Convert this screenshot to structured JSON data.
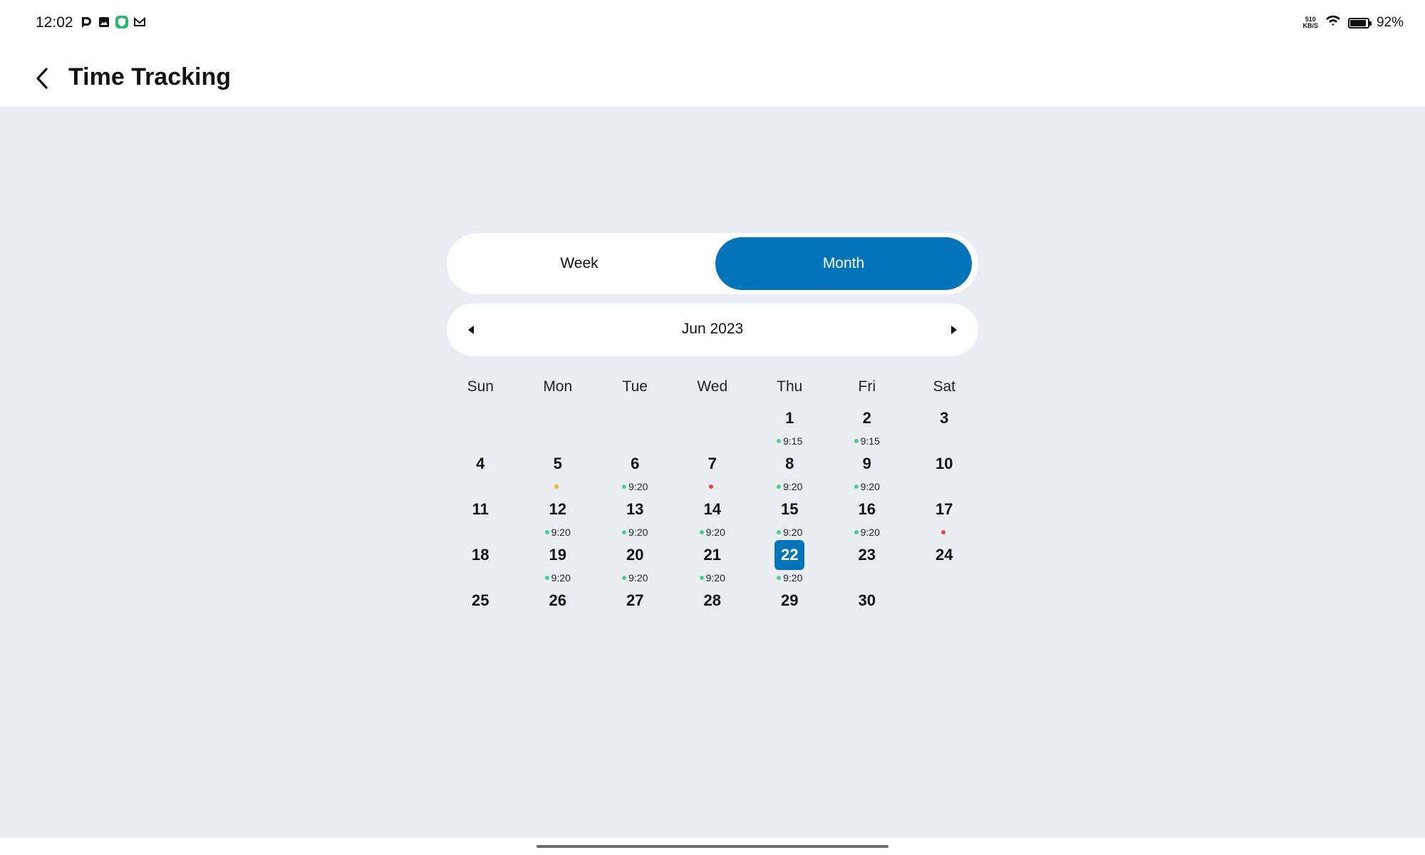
{
  "status": {
    "time": "12:02",
    "net_speed_value": "510",
    "net_speed_unit": "KB/S",
    "battery": "92%",
    "battery_level": 0.92,
    "icons": [
      "app-d-icon",
      "gallery-icon",
      "shield-app-icon",
      "mail-icon"
    ]
  },
  "header": {
    "title": "Time Tracking"
  },
  "toggle": {
    "week_label": "Week",
    "month_label": "Month",
    "selected": "Month"
  },
  "month_nav": {
    "label": "Jun 2023"
  },
  "colors": {
    "accent": "#0475b9",
    "dot_green": "#47d18c",
    "dot_orange": "#f2b21c",
    "dot_red": "#f0433a"
  },
  "calendar": {
    "weekdays": [
      "Sun",
      "Mon",
      "Tue",
      "Wed",
      "Thu",
      "Fri",
      "Sat"
    ],
    "today": "22",
    "weeks": [
      [
        {
          "day": "",
          "status": "",
          "hours": ""
        },
        {
          "day": "",
          "status": "",
          "hours": ""
        },
        {
          "day": "",
          "status": "",
          "hours": ""
        },
        {
          "day": "",
          "status": "",
          "hours": ""
        },
        {
          "day": "1",
          "status": "green",
          "hours": "9:15"
        },
        {
          "day": "2",
          "status": "green",
          "hours": "9:15"
        },
        {
          "day": "3",
          "status": "",
          "hours": ""
        }
      ],
      [
        {
          "day": "4",
          "status": "",
          "hours": ""
        },
        {
          "day": "5",
          "status": "orange",
          "hours": ""
        },
        {
          "day": "6",
          "status": "green",
          "hours": "9:20"
        },
        {
          "day": "7",
          "status": "red",
          "hours": ""
        },
        {
          "day": "8",
          "status": "green",
          "hours": "9:20"
        },
        {
          "day": "9",
          "status": "green",
          "hours": "9:20"
        },
        {
          "day": "10",
          "status": "",
          "hours": ""
        }
      ],
      [
        {
          "day": "11",
          "status": "",
          "hours": ""
        },
        {
          "day": "12",
          "status": "green",
          "hours": "9:20"
        },
        {
          "day": "13",
          "status": "green",
          "hours": "9:20"
        },
        {
          "day": "14",
          "status": "green",
          "hours": "9:20"
        },
        {
          "day": "15",
          "status": "green",
          "hours": "9:20"
        },
        {
          "day": "16",
          "status": "green",
          "hours": "9:20"
        },
        {
          "day": "17",
          "status": "red",
          "hours": ""
        }
      ],
      [
        {
          "day": "18",
          "status": "",
          "hours": ""
        },
        {
          "day": "19",
          "status": "green",
          "hours": "9:20"
        },
        {
          "day": "20",
          "status": "green",
          "hours": "9:20"
        },
        {
          "day": "21",
          "status": "green",
          "hours": "9:20"
        },
        {
          "day": "22",
          "status": "green",
          "hours": "9:20"
        },
        {
          "day": "23",
          "status": "",
          "hours": ""
        },
        {
          "day": "24",
          "status": "",
          "hours": ""
        }
      ],
      [
        {
          "day": "25",
          "status": "",
          "hours": ""
        },
        {
          "day": "26",
          "status": "",
          "hours": ""
        },
        {
          "day": "27",
          "status": "",
          "hours": ""
        },
        {
          "day": "28",
          "status": "",
          "hours": ""
        },
        {
          "day": "29",
          "status": "",
          "hours": ""
        },
        {
          "day": "30",
          "status": "",
          "hours": ""
        },
        {
          "day": "",
          "status": "",
          "hours": ""
        }
      ]
    ]
  }
}
